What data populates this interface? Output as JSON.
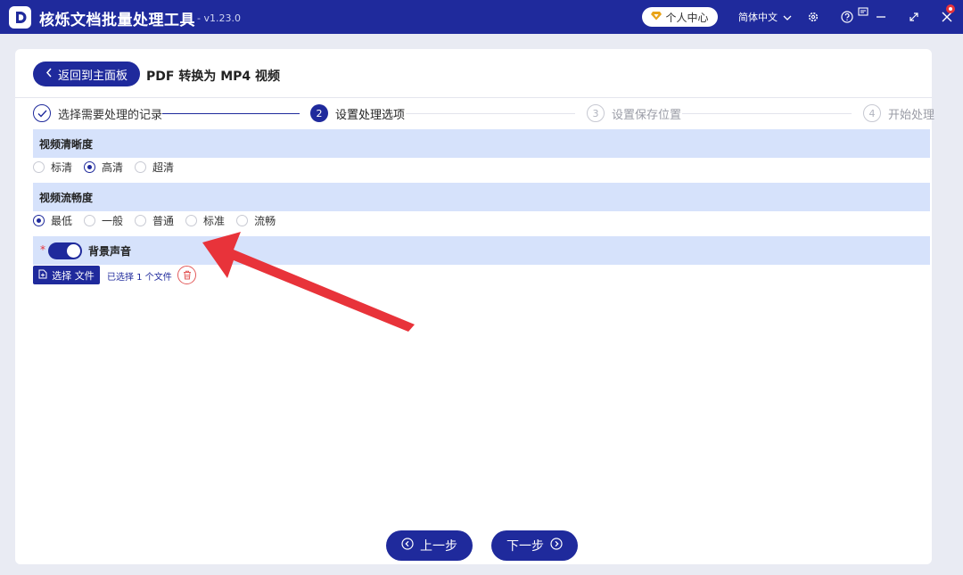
{
  "titlebar": {
    "app_title": "核烁文档批量处理工具",
    "version": "- v1.23.0",
    "user_center": "个人中心",
    "language": "简体中文"
  },
  "header": {
    "back_label": "返回到主面板",
    "page_title": "PDF 转换为 MP4 视频"
  },
  "steps": [
    {
      "num": "",
      "label": "选择需要处理的记录",
      "state": "done"
    },
    {
      "num": "2",
      "label": "设置处理选项",
      "state": "active"
    },
    {
      "num": "3",
      "label": "设置保存位置",
      "state": "pending"
    },
    {
      "num": "4",
      "label": "开始处理",
      "state": "pending"
    }
  ],
  "sections": {
    "resolution": {
      "title": "视频清晰度",
      "options": [
        "标清",
        "高清",
        "超清"
      ],
      "selected": "高清"
    },
    "fluency": {
      "title": "视频流畅度",
      "options": [
        "最低",
        "一般",
        "普通",
        "标准",
        "流畅"
      ],
      "selected": "最低"
    },
    "bgm": {
      "required_mark": "*",
      "title": "背景声音",
      "enabled": true,
      "file_button": "选择 文件",
      "file_status": "已选择 1 个文件"
    }
  },
  "footer": {
    "prev_label": "上一步",
    "next_label": "下一步"
  },
  "colors": {
    "primary": "#1f2a9c",
    "section_bg": "#d6e2fb",
    "annotation_arrow": "#e8333a"
  }
}
